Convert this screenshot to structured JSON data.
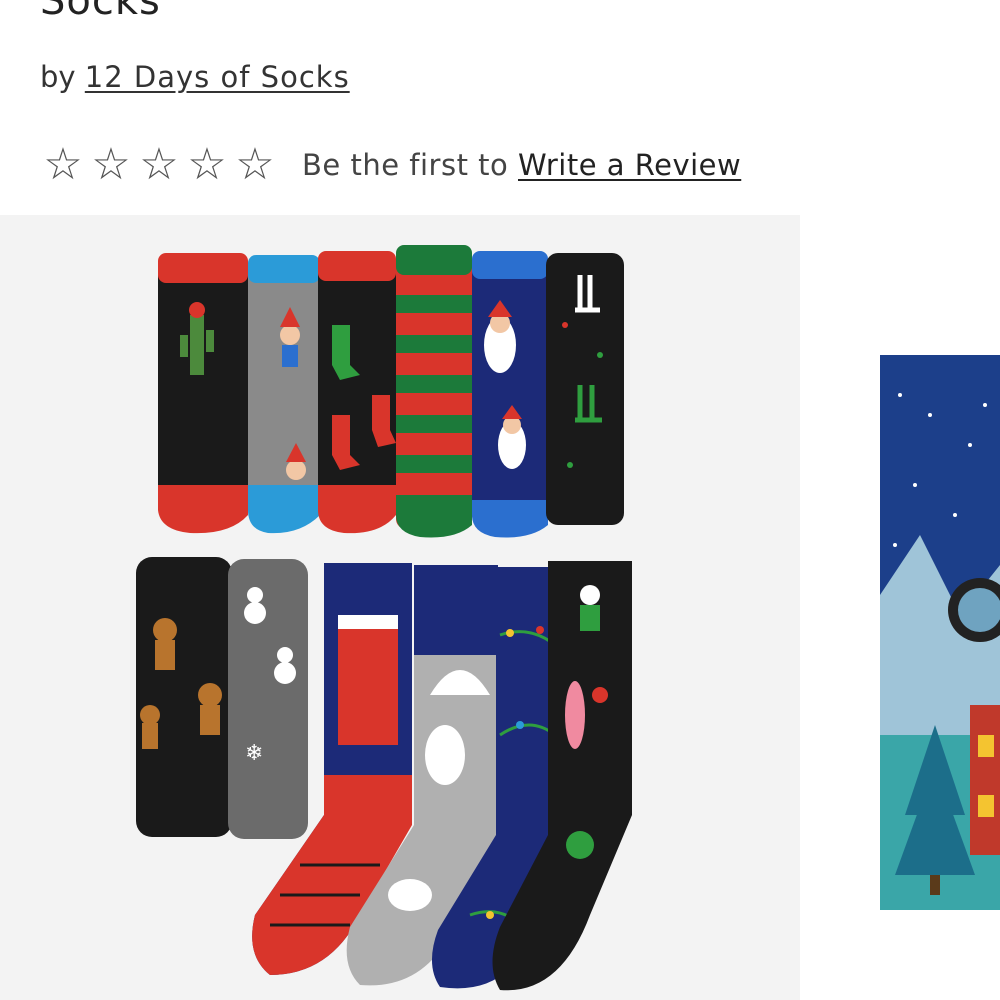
{
  "product": {
    "title_fragment": "Socks",
    "by_prefix": "by",
    "brand": "12 Days of Socks"
  },
  "rating": {
    "stars_filled": 0,
    "stars_total": 5,
    "prompt": "Be the first to",
    "write_review_label": "Write a Review"
  },
  "images": {
    "main_alt": "12 pairs of holiday socks",
    "thumb_alt": "gift box with holiday scene"
  },
  "colors": {
    "red": "#d9352b",
    "green": "#1c7a3a",
    "navy": "#1c2a78",
    "black": "#1a1a1a",
    "blue": "#2b9bd8",
    "gray": "#8a8a8a"
  }
}
